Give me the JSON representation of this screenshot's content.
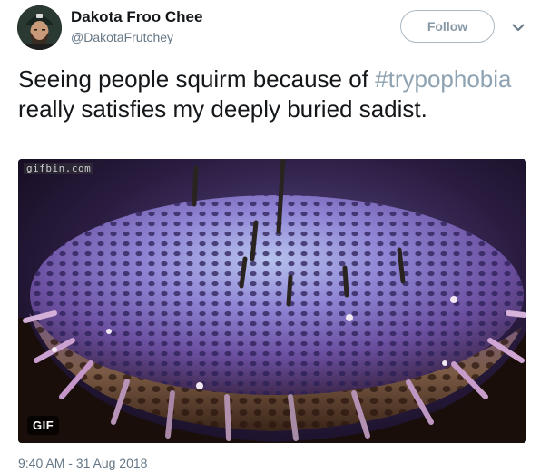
{
  "user": {
    "display_name": "Dakota Froo Chee",
    "handle": "@DakotaFrutchey"
  },
  "follow_button": {
    "label": "Follow"
  },
  "tweet": {
    "text_before": "Seeing people squirm because of ",
    "hashtag": "#trypophobia",
    "text_after": " really satisfies my deeply buried sadist."
  },
  "media": {
    "watermark": "gifbin.com",
    "badge": "GIF"
  },
  "timestamp": "9:40 AM - 31 Aug 2018",
  "colors": {
    "text": "#14171a",
    "secondary": "#657786",
    "hashtag": "#8ea2b1",
    "follow_border": "#aab8c2"
  },
  "icons": {
    "more": "chevron-down-icon"
  }
}
